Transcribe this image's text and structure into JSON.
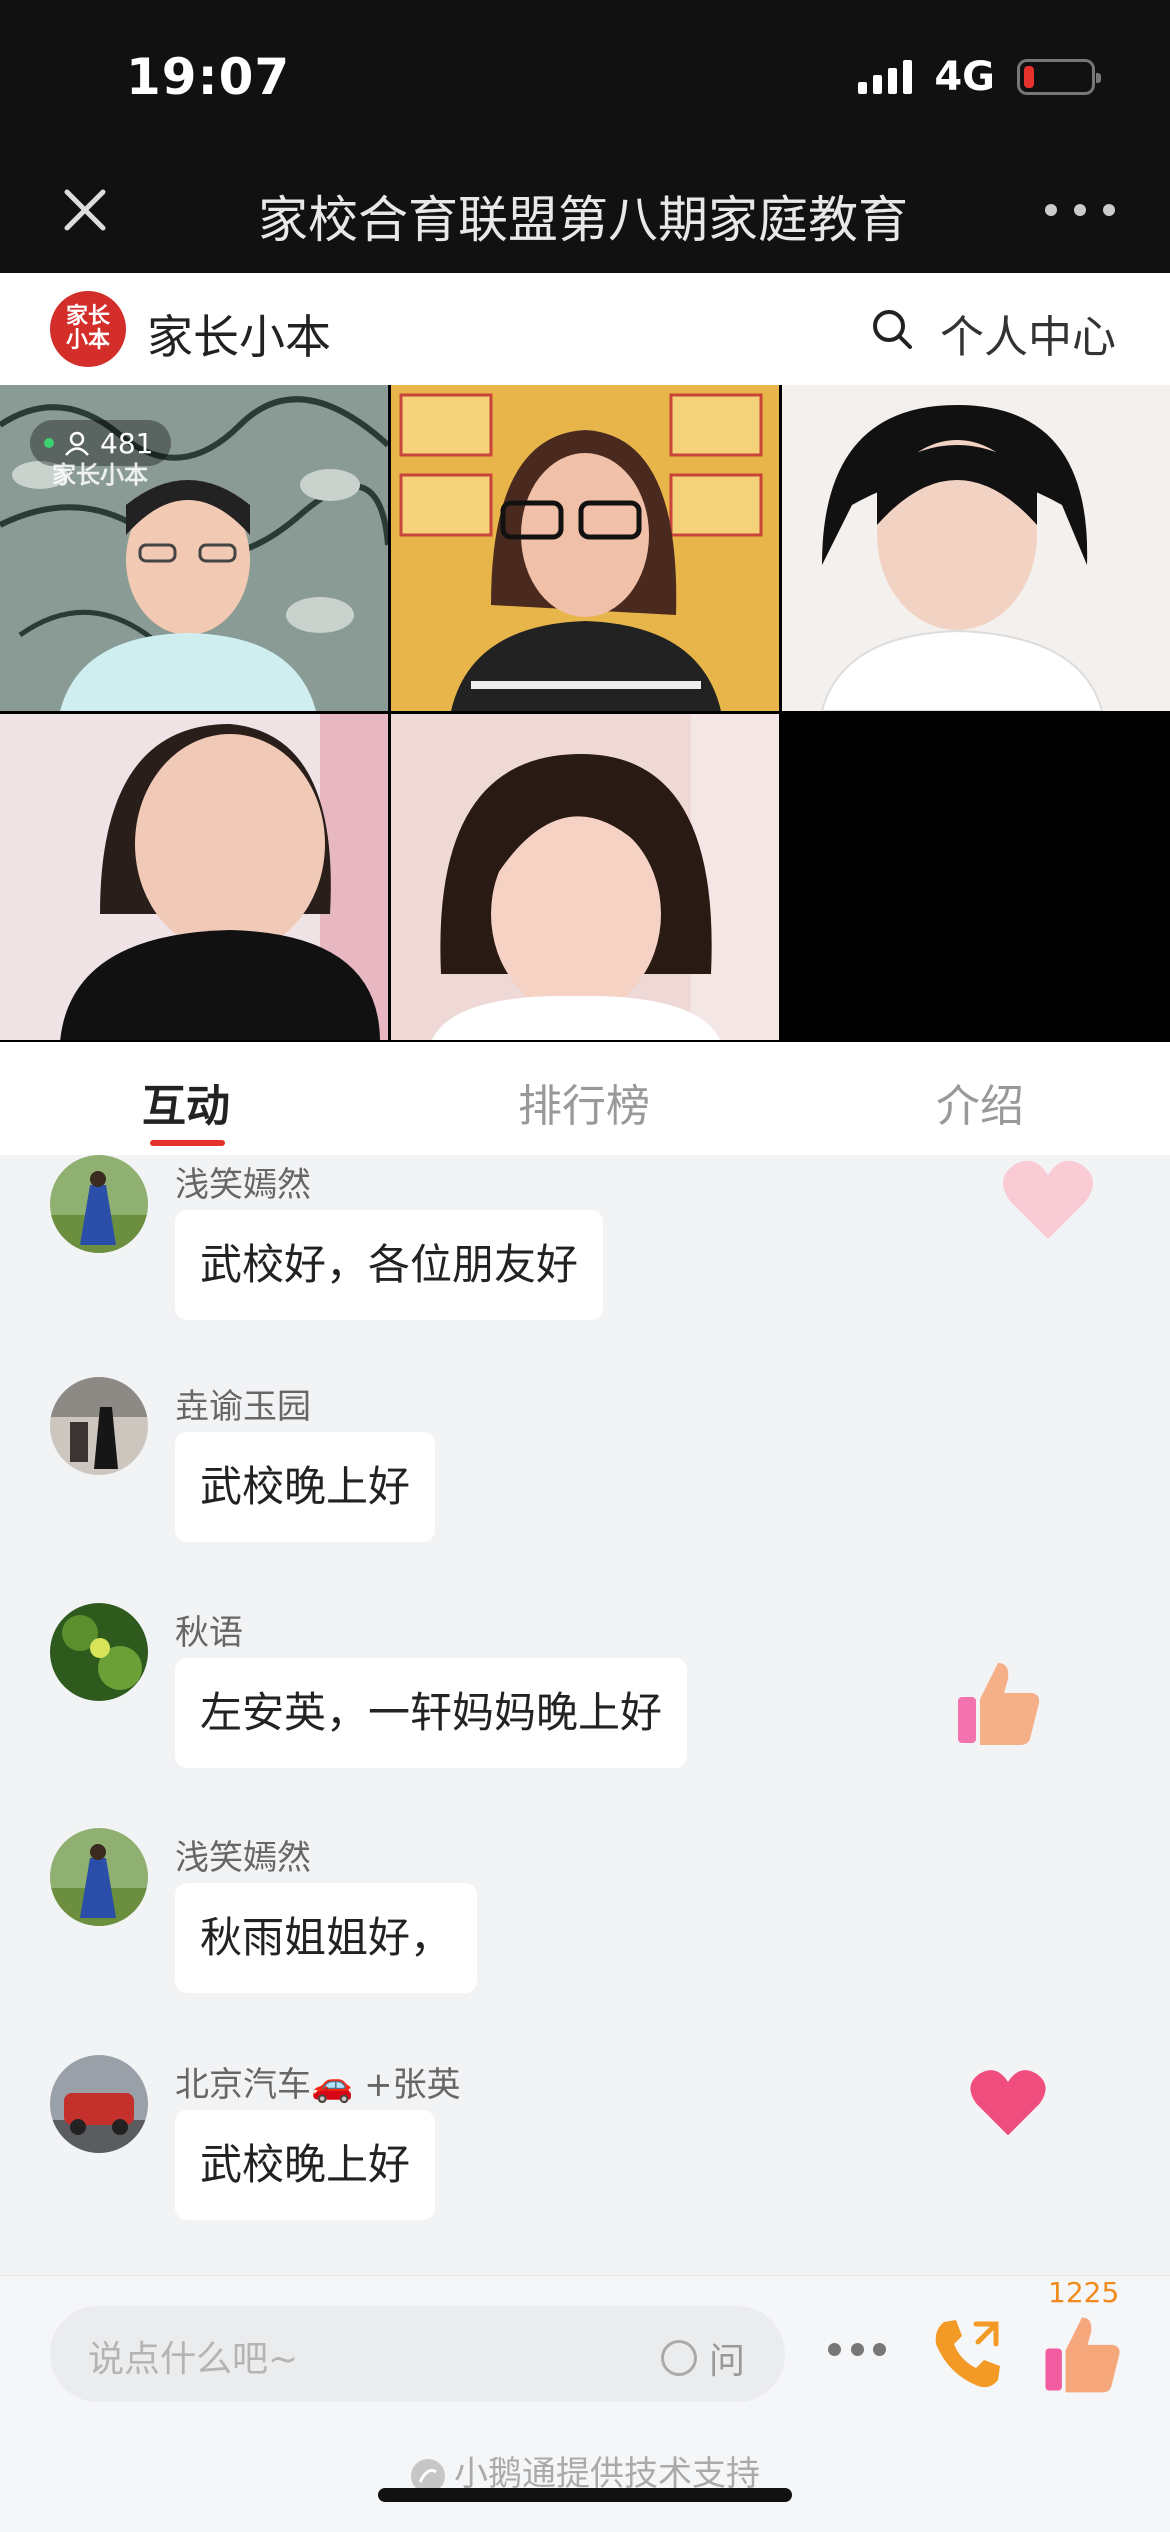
{
  "status_bar": {
    "time": "19:07",
    "network": "4G",
    "battery_level": 0.16
  },
  "title_bar": {
    "title": "家校合育联盟第八期家庭教育"
  },
  "app_header": {
    "logo_text_line1": "家长",
    "logo_text_line2": "小本",
    "app_name": "家长小本",
    "personal_center": "个人中心",
    "brand_color": "#d42e2a"
  },
  "video": {
    "viewer_count": "481",
    "watermark": "家长小本",
    "participants": 5
  },
  "tabs": [
    {
      "label": "互动",
      "active": true
    },
    {
      "label": "排行榜",
      "active": false
    },
    {
      "label": "介绍",
      "active": false
    }
  ],
  "messages": [
    {
      "name": "浅笑嫣然",
      "text": "武校好，各位朋友好"
    },
    {
      "name": "垚谕玉园",
      "text": "武校晚上好"
    },
    {
      "name": "秋语",
      "text": "左安英，一轩妈妈晚上好"
    },
    {
      "name": "浅笑嫣然",
      "text": "秋雨姐姐好，"
    },
    {
      "name": "北京汽车🚗 +张英",
      "text": "武校晚上好"
    }
  ],
  "bottom_bar": {
    "input_placeholder": "说点什么吧~",
    "ask_label": "问",
    "like_count": "1225",
    "tech_support": "小鹅通提供技术支持"
  },
  "icons": {
    "close": "close-icon",
    "more": "more-icon",
    "search": "search-icon",
    "call": "phone-icon",
    "like": "thumbs-up-icon"
  }
}
